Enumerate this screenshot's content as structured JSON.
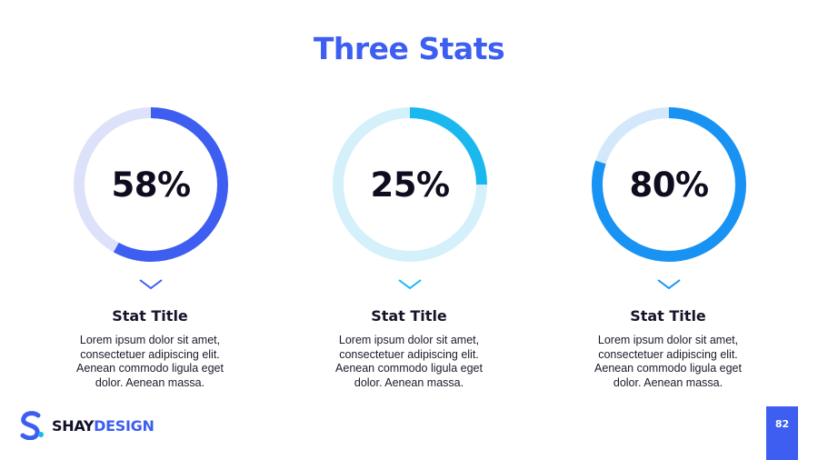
{
  "title": "Three Stats",
  "stats": [
    {
      "value": "58%",
      "fraction": 0.58,
      "title": "Stat Title",
      "desc": [
        "Lorem ipsum dolor sit amet,",
        "consectetuer adipiscing elit.",
        "Aenean commodo ligula eget",
        "dolor. Aenean massa."
      ],
      "color": "#3d5ef0",
      "track_color": "#dde2fa"
    },
    {
      "value": "25%",
      "fraction": 0.25,
      "title": "Stat Title",
      "desc": [
        "Lorem ipsum dolor sit amet,",
        "consectetuer adipiscing elit.",
        "Aenean commodo ligula eget",
        "dolor. Aenean massa."
      ],
      "color": "#1ab8ef",
      "track_color": "#d4f0fb"
    },
    {
      "value": "80%",
      "fraction": 0.8,
      "title": "Stat Title",
      "desc": [
        "Lorem ipsum dolor sit amet,",
        "consectetuer adipiscing elit.",
        "Aenean commodo ligula eget",
        "dolor. Aenean massa."
      ],
      "color": "#1893f3",
      "track_color": "#d3e8fb"
    }
  ],
  "logo": {
    "part1": "SHAY",
    "part2": "DESIGN"
  },
  "page_number": "82",
  "colors": {
    "accent": "#3d5ef0",
    "text": "#0d0d1f"
  },
  "icons": {
    "chevron": "chevron-down-icon",
    "logo": "logo-mark-icon"
  }
}
